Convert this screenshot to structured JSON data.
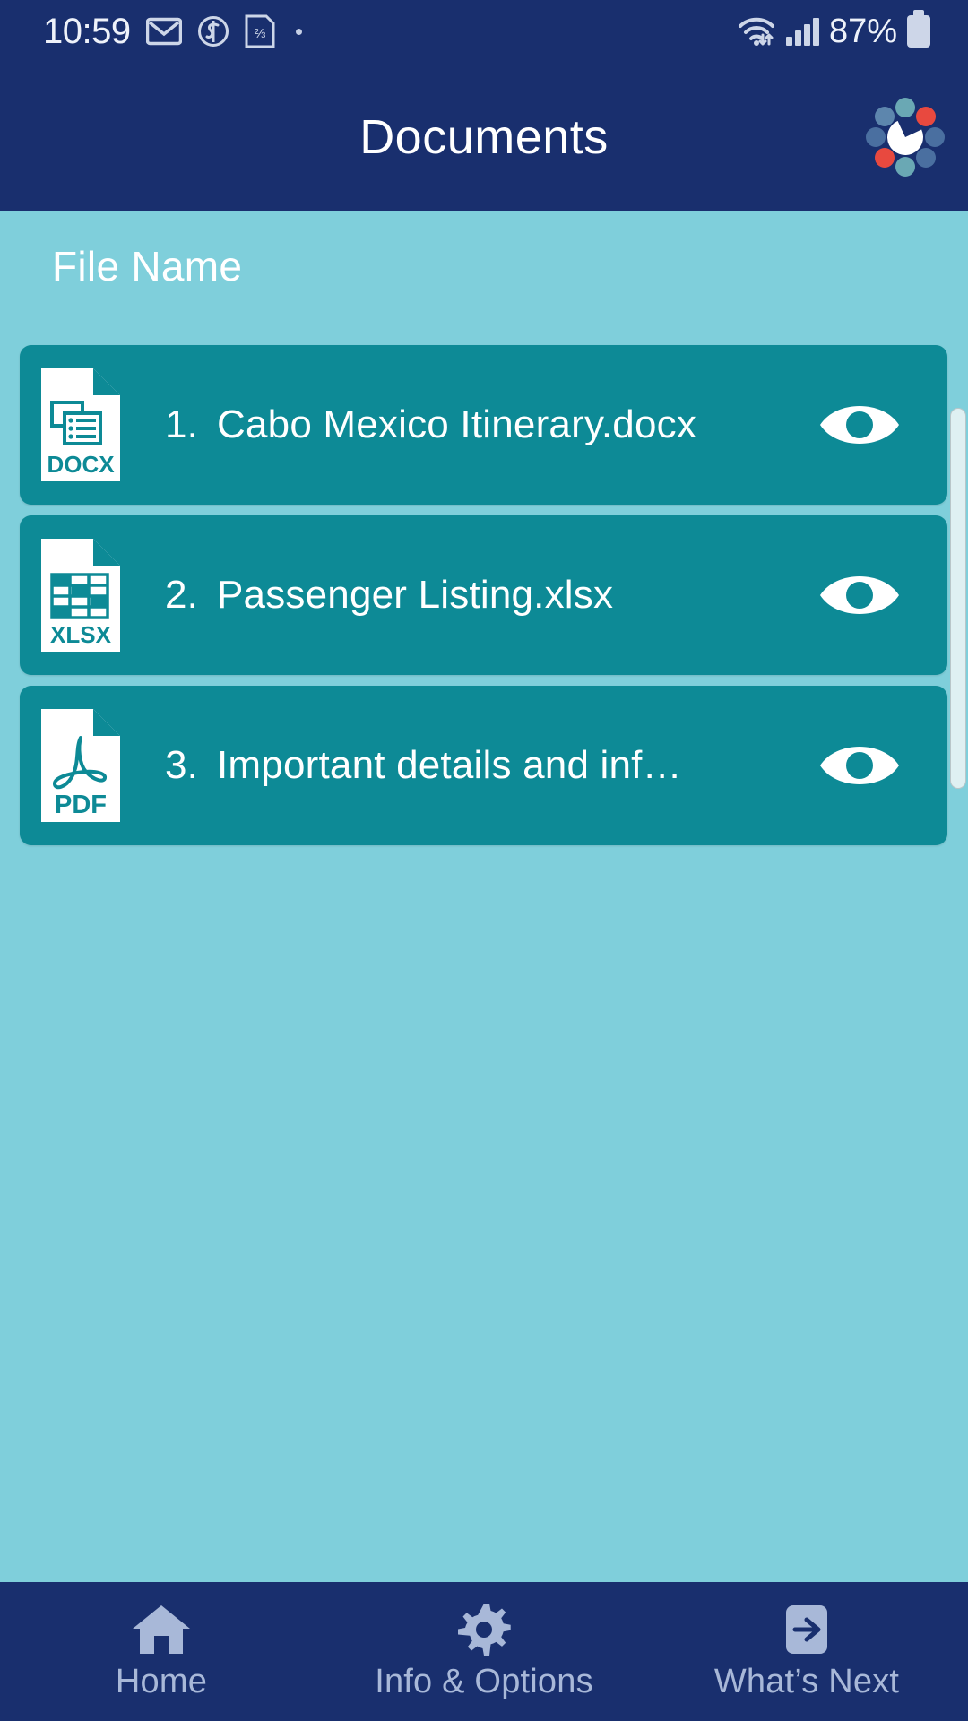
{
  "statusbar": {
    "time": "10:59",
    "battery_percent": "87%",
    "icons": [
      "mail-icon",
      "s-circle-icon",
      "sim-card-icon",
      "dot-icon",
      "wifi-icon",
      "cellular-signal-icon",
      "battery-icon"
    ]
  },
  "header": {
    "title": "Documents",
    "logo_name": "app-logo",
    "background_color": "#192f6e",
    "title_color": "#ffffff",
    "logo_colors": {
      "teal": "#6aa8b4",
      "blue": "#4a6fa0",
      "red": "#e8493f",
      "white": "#ffffff"
    }
  },
  "content": {
    "background_color": "#7fcfdb",
    "list_header": "File Name",
    "card_color": "#0d8a96",
    "files": [
      {
        "index": "1.",
        "name": "Cabo Mexico Itinerary.docx",
        "type": "DOCX",
        "icon": "docx-file-icon",
        "action_icon": "eye-icon"
      },
      {
        "index": "2.",
        "name": "Passenger Listing.xlsx",
        "type": "XLSX",
        "icon": "xlsx-file-icon",
        "action_icon": "eye-icon"
      },
      {
        "index": "3.",
        "name": "Important details and inf…",
        "type": "PDF",
        "icon": "pdf-file-icon",
        "action_icon": "eye-icon"
      }
    ]
  },
  "bottomnav": {
    "background_color": "#192f6e",
    "item_color": "#a8b8d8",
    "items": [
      {
        "label": "Home",
        "icon": "home-icon"
      },
      {
        "label": "Info & Options",
        "icon": "gear-icon"
      },
      {
        "label": "What’s Next",
        "icon": "arrow-right-box-icon"
      }
    ]
  }
}
